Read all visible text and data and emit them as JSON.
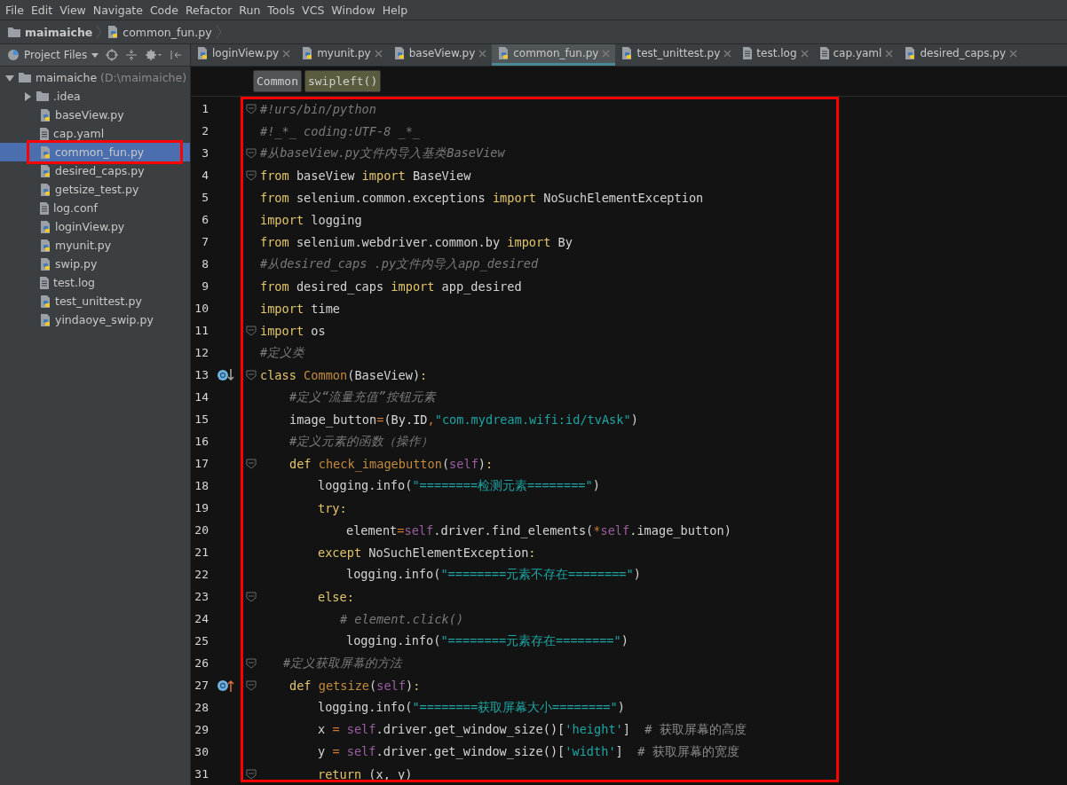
{
  "menu": [
    "File",
    "Edit",
    "View",
    "Navigate",
    "Code",
    "Refactor",
    "Run",
    "Tools",
    "VCS",
    "Window",
    "Help"
  ],
  "breadcrumb": [
    {
      "label": "maimaiche",
      "kind": "folder"
    },
    {
      "label": "common_fun.py",
      "kind": "python"
    }
  ],
  "project_panel": {
    "title": "Project Files",
    "tree": {
      "label": "maimaiche",
      "path": "(D:\\maimaiche)",
      "expanded": true,
      "children": [
        {
          "label": ".idea",
          "kind": "folder",
          "expanded": false,
          "selected": false
        },
        {
          "label": "baseView.py",
          "kind": "python",
          "selected": false
        },
        {
          "label": "cap.yaml",
          "kind": "text",
          "selected": false
        },
        {
          "label": "common_fun.py",
          "kind": "python",
          "selected": true
        },
        {
          "label": "desired_caps.py",
          "kind": "python",
          "selected": false
        },
        {
          "label": "getsize_test.py",
          "kind": "python",
          "selected": false
        },
        {
          "label": "log.conf",
          "kind": "text",
          "selected": false
        },
        {
          "label": "loginView.py",
          "kind": "python",
          "selected": false
        },
        {
          "label": "myunit.py",
          "kind": "python",
          "selected": false
        },
        {
          "label": "swip.py",
          "kind": "python",
          "selected": false
        },
        {
          "label": "test.log",
          "kind": "text",
          "selected": false
        },
        {
          "label": "test_unittest.py",
          "kind": "python",
          "selected": false
        },
        {
          "label": "yindaoye_swip.py",
          "kind": "python",
          "selected": false
        }
      ]
    }
  },
  "tabs": [
    {
      "label": "loginView.py",
      "kind": "python",
      "selected": false
    },
    {
      "label": "myunit.py",
      "kind": "python",
      "selected": false
    },
    {
      "label": "baseView.py",
      "kind": "python",
      "selected": false
    },
    {
      "label": "common_fun.py",
      "kind": "python",
      "selected": true
    },
    {
      "label": "test_unittest.py",
      "kind": "python",
      "selected": false
    },
    {
      "label": "test.log",
      "kind": "text",
      "selected": false
    },
    {
      "label": "cap.yaml",
      "kind": "text",
      "selected": false
    },
    {
      "label": "desired_caps.py",
      "kind": "python",
      "selected": false
    }
  ],
  "structure_path": [
    {
      "label": "Common",
      "kind": "class"
    },
    {
      "label": "swipleft()",
      "kind": "method"
    }
  ],
  "code": [
    {
      "number": "1",
      "fold": true,
      "kind": "top",
      "tokens": [
        {
          "kind": "comment",
          "text": "#!urs/bin/python"
        }
      ]
    },
    {
      "number": "2",
      "fold": false,
      "kind": "top",
      "tokens": [
        {
          "kind": "comment",
          "text": "#!_*_ coding:UTF-8 _*_"
        }
      ]
    },
    {
      "number": "3",
      "fold": true,
      "kind": "top",
      "tokens": [
        {
          "kind": "comment",
          "text": "#从baseView.py文件内导入基类BaseView"
        }
      ]
    },
    {
      "number": "4",
      "fold": true,
      "kind": "top",
      "tokens": [
        {
          "kind": "kw",
          "text": "from"
        },
        {
          "kind": "text",
          "text": " baseView "
        },
        {
          "kind": "kw",
          "text": "import"
        },
        {
          "kind": "text",
          "text": " BaseView"
        }
      ]
    },
    {
      "number": "5",
      "fold": false,
      "kind": "top",
      "tokens": [
        {
          "kind": "kw",
          "text": "from"
        },
        {
          "kind": "text",
          "text": " selenium.common.exceptions "
        },
        {
          "kind": "kw",
          "text": "import"
        },
        {
          "kind": "text",
          "text": " NoSuchElementException"
        }
      ]
    },
    {
      "number": "6",
      "fold": false,
      "kind": "top",
      "tokens": [
        {
          "kind": "kw",
          "text": "import"
        },
        {
          "kind": "text",
          "text": " logging"
        }
      ]
    },
    {
      "number": "7",
      "fold": false,
      "kind": "top",
      "tokens": [
        {
          "kind": "kw",
          "text": "from"
        },
        {
          "kind": "text",
          "text": " selenium.webdriver.common.by "
        },
        {
          "kind": "kw",
          "text": "import"
        },
        {
          "kind": "text",
          "text": " By"
        }
      ]
    },
    {
      "number": "8",
      "fold": false,
      "kind": "top",
      "tokens": [
        {
          "kind": "comment",
          "text": "#从desired_caps .py文件内导入app_desired"
        }
      ]
    },
    {
      "number": "9",
      "fold": false,
      "kind": "top",
      "tokens": [
        {
          "kind": "kw",
          "text": "from"
        },
        {
          "kind": "text",
          "text": " desired_caps "
        },
        {
          "kind": "kw",
          "text": "import"
        },
        {
          "kind": "text",
          "text": " app_desired"
        }
      ]
    },
    {
      "number": "10",
      "fold": false,
      "kind": "top",
      "tokens": [
        {
          "kind": "kw",
          "text": "import"
        },
        {
          "kind": "text",
          "text": " time"
        }
      ]
    },
    {
      "number": "11",
      "fold": true,
      "kind": "top",
      "tokens": [
        {
          "kind": "kw",
          "text": "import"
        },
        {
          "kind": "text",
          "text": " os"
        }
      ]
    },
    {
      "number": "12",
      "fold": false,
      "kind": "top",
      "tokens": [
        {
          "kind": "comment",
          "text": "#定义类"
        }
      ]
    },
    {
      "number": "13",
      "fold": true,
      "kind": "top",
      "gutter_icon": {
        "kind": "implemented"
      },
      "tokens": [
        {
          "kind": "kw",
          "text": "class"
        },
        {
          "kind": "name",
          "text": " Common"
        },
        {
          "kind": "text",
          "text": "(BaseView)"
        },
        {
          "kind": "kw",
          "text": ":"
        }
      ]
    },
    {
      "number": "14",
      "fold": false,
      "kind": "class",
      "tokens": [
        {
          "kind": "comment",
          "text": "#定义“流量充值”按钮元素"
        }
      ]
    },
    {
      "number": "15",
      "fold": false,
      "kind": "class",
      "tokens": [
        {
          "kind": "text",
          "text": "image_button"
        },
        {
          "kind": "op",
          "text": "="
        },
        {
          "kind": "text",
          "text": "(By.ID"
        },
        {
          "kind": "op",
          "text": ","
        },
        {
          "kind": "str",
          "text": "\"com.mydream.wifi:id/tvAsk\""
        },
        {
          "kind": "text",
          "text": ")"
        }
      ]
    },
    {
      "number": "16",
      "fold": false,
      "kind": "class",
      "tokens": [
        {
          "kind": "comment",
          "text": "#定义元素的函数（操作）"
        }
      ]
    },
    {
      "number": "17",
      "fold": true,
      "kind": "class",
      "tokens": [
        {
          "kind": "kw",
          "text": "def"
        },
        {
          "kind": "name",
          "text": " check_imagebutton"
        },
        {
          "kind": "text",
          "text": "("
        },
        {
          "kind": "self",
          "text": "self"
        },
        {
          "kind": "text",
          "text": ")"
        },
        {
          "kind": "kw",
          "text": ":"
        }
      ]
    },
    {
      "number": "18",
      "fold": false,
      "kind": "method",
      "tokens": [
        {
          "kind": "text",
          "text": "logging.info("
        },
        {
          "kind": "str",
          "text": "\"========检测元素========\""
        },
        {
          "kind": "text",
          "text": ")"
        }
      ]
    },
    {
      "number": "19",
      "fold": false,
      "kind": "method",
      "tokens": [
        {
          "kind": "kw",
          "text": "try:"
        }
      ]
    },
    {
      "number": "20",
      "fold": false,
      "kind": "block",
      "tokens": [
        {
          "kind": "text",
          "text": "element"
        },
        {
          "kind": "op",
          "text": "="
        },
        {
          "kind": "self",
          "text": "self"
        },
        {
          "kind": "text",
          "text": ".driver.find_elements("
        },
        {
          "kind": "op",
          "text": "*"
        },
        {
          "kind": "self",
          "text": "self"
        },
        {
          "kind": "text",
          "text": ".image_button)"
        }
      ]
    },
    {
      "number": "21",
      "fold": false,
      "kind": "method",
      "tokens": [
        {
          "kind": "kw",
          "text": "except"
        },
        {
          "kind": "text",
          "text": " NoSuchElementException"
        },
        {
          "kind": "kw",
          "text": ":"
        }
      ]
    },
    {
      "number": "22",
      "fold": false,
      "kind": "block",
      "tokens": [
        {
          "kind": "text",
          "text": "logging.info("
        },
        {
          "kind": "str",
          "text": "\"========元素不存在========\""
        },
        {
          "kind": "text",
          "text": ")"
        }
      ]
    },
    {
      "number": "23",
      "fold": true,
      "kind": "method",
      "tokens": [
        {
          "kind": "kw",
          "text": "else:"
        }
      ]
    },
    {
      "number": "24",
      "fold": false,
      "kind": "block_comment",
      "tokens": [
        {
          "kind": "comment",
          "text": "# element.click()"
        }
      ]
    },
    {
      "number": "25",
      "fold": false,
      "kind": "block",
      "tokens": [
        {
          "kind": "text",
          "text": "logging.info("
        },
        {
          "kind": "str",
          "text": "\"========元素存在========\""
        },
        {
          "kind": "text",
          "text": ")"
        }
      ]
    },
    {
      "number": "26",
      "fold": true,
      "kind": "class_comment",
      "tokens": [
        {
          "kind": "comment",
          "text": "#定义获取屏幕的方法"
        }
      ]
    },
    {
      "number": "27",
      "fold": true,
      "kind": "class",
      "gutter_icon": {
        "kind": "overrides"
      },
      "tokens": [
        {
          "kind": "kw",
          "text": "def"
        },
        {
          "kind": "name",
          "text": " getsize"
        },
        {
          "kind": "text",
          "text": "("
        },
        {
          "kind": "self",
          "text": "self"
        },
        {
          "kind": "text",
          "text": ")"
        },
        {
          "kind": "kw",
          "text": ":"
        }
      ]
    },
    {
      "number": "28",
      "fold": false,
      "kind": "method",
      "tokens": [
        {
          "kind": "text",
          "text": "logging.info("
        },
        {
          "kind": "str",
          "text": "\"========获取屏幕大小========\""
        },
        {
          "kind": "text",
          "text": ")"
        }
      ]
    },
    {
      "number": "29",
      "fold": false,
      "kind": "method",
      "tokens": [
        {
          "kind": "text",
          "text": "x "
        },
        {
          "kind": "op",
          "text": "="
        },
        {
          "kind": "self",
          "text": " self"
        },
        {
          "kind": "text",
          "text": ".driver.get_window_size()["
        },
        {
          "kind": "str",
          "text": "'height'"
        },
        {
          "kind": "text",
          "text": "]  "
        },
        {
          "kind": "comment2",
          "text": "# 获取屏幕的高度"
        }
      ]
    },
    {
      "number": "30",
      "fold": false,
      "kind": "method",
      "tokens": [
        {
          "kind": "text",
          "text": "y "
        },
        {
          "kind": "op",
          "text": "="
        },
        {
          "kind": "self",
          "text": " self"
        },
        {
          "kind": "text",
          "text": ".driver.get_window_size()["
        },
        {
          "kind": "str",
          "text": "'width'"
        },
        {
          "kind": "text",
          "text": "]  "
        },
        {
          "kind": "comment2",
          "text": "# 获取屏幕的宽度"
        }
      ]
    },
    {
      "number": "31",
      "fold": true,
      "kind": "method",
      "tokens": [
        {
          "kind": "kw",
          "text": "return"
        },
        {
          "kind": "text",
          "text": " (x, y)"
        }
      ]
    }
  ]
}
